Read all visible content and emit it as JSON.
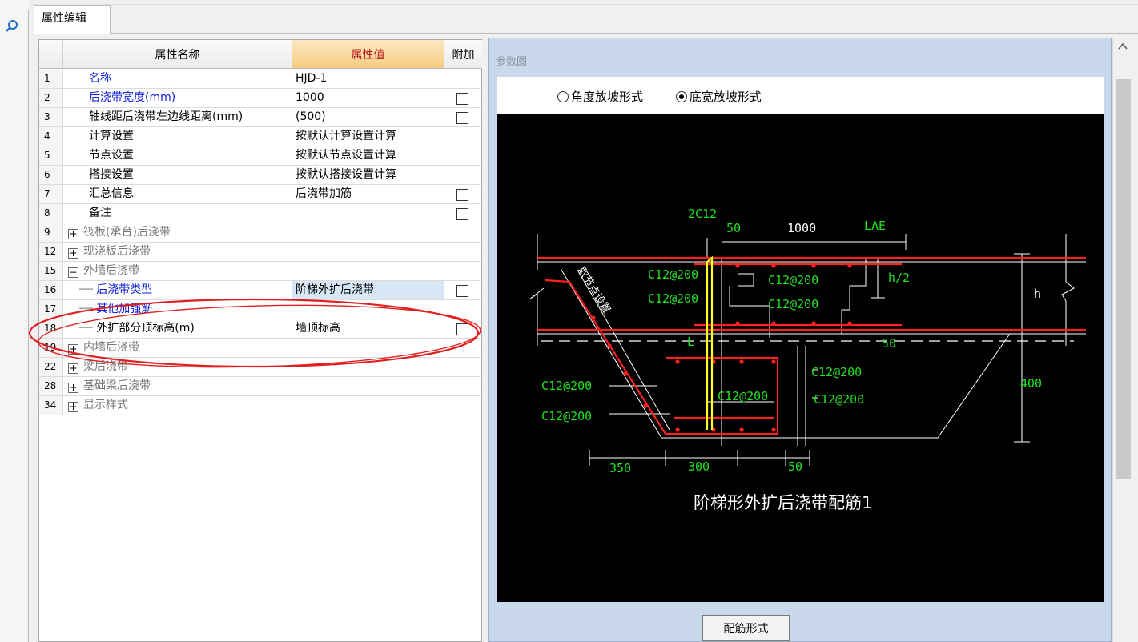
{
  "tab": {
    "label": "属性编辑"
  },
  "table": {
    "headers": {
      "name": "属性名称",
      "value": "属性值",
      "extra": "附加"
    },
    "rows": [
      {
        "no": "1",
        "name": "名称",
        "value": "HJD-1",
        "style": "blue",
        "check": false
      },
      {
        "no": "2",
        "name": "后浇带宽度(mm)",
        "value": "1000",
        "style": "blue",
        "check": true
      },
      {
        "no": "3",
        "name": "轴线距后浇带左边线距离(mm)",
        "value": "(500)",
        "style": "",
        "check": true
      },
      {
        "no": "4",
        "name": "计算设置",
        "value": "按默认计算设置计算",
        "style": "",
        "check": false
      },
      {
        "no": "5",
        "name": "节点设置",
        "value": "按默认节点设置计算",
        "style": "",
        "check": false
      },
      {
        "no": "6",
        "name": "搭接设置",
        "value": "按默认搭接设置计算",
        "style": "",
        "check": false
      },
      {
        "no": "7",
        "name": "汇总信息",
        "value": "后浇带加筋",
        "style": "",
        "check": true
      },
      {
        "no": "8",
        "name": "备注",
        "value": "",
        "style": "",
        "check": true
      },
      {
        "no": "9",
        "name": "筏板(承台)后浇带",
        "value": "",
        "style": "group",
        "toggle": "+",
        "check": false
      },
      {
        "no": "12",
        "name": "现浇板后浇带",
        "value": "",
        "style": "group",
        "toggle": "+",
        "check": false
      },
      {
        "no": "15",
        "name": "外墙后浇带",
        "value": "",
        "style": "group",
        "toggle": "−",
        "check": false
      },
      {
        "no": "16",
        "name": "后浇带类型",
        "value": "阶梯外扩后浇带",
        "style": "child-selected",
        "check": true
      },
      {
        "no": "17",
        "name": "其他加强筋",
        "value": "",
        "style": "child-blue",
        "check": false
      },
      {
        "no": "18",
        "name": "外扩部分顶标高(m)",
        "value": "墙顶标高",
        "style": "child",
        "check": true
      },
      {
        "no": "19",
        "name": "内墙后浇带",
        "value": "",
        "style": "group",
        "toggle": "+",
        "check": false
      },
      {
        "no": "22",
        "name": "梁后浇带",
        "value": "",
        "style": "group",
        "toggle": "+",
        "check": false
      },
      {
        "no": "28",
        "name": "基础梁后浇带",
        "value": "",
        "style": "group",
        "toggle": "+",
        "check": false
      },
      {
        "no": "34",
        "name": "显示样式",
        "value": "",
        "style": "group",
        "toggle": "+",
        "check": false
      }
    ]
  },
  "panel": {
    "title": "参数图",
    "options": [
      {
        "label": "角度放坡形式",
        "selected": false
      },
      {
        "label": "底宽放坡形式",
        "selected": true
      }
    ],
    "button": "配筋形式"
  },
  "drawing": {
    "caption": "阶梯形外扩后浇带配筋1",
    "labels": {
      "top_bar": "2C12",
      "dim_50_top": "50",
      "dim_1000": "1000",
      "dim_lae": "LAE",
      "bar_a": "C12@200",
      "bar_b": "C12@200",
      "bar_c": "C12@200",
      "bar_d": "C12@200",
      "bar_e": "C12@200",
      "bar_f": "C12@200",
      "bar_g": "C12@200",
      "bar_h": "C12@200",
      "bar_i": "C12@200",
      "h2": "h/2",
      "h": "h",
      "L": "L",
      "dim_50_right": "50",
      "dim_400": "400",
      "dim_350": "350",
      "dim_300": "300",
      "dim_50_bottom": "50",
      "node_text": "取节点设置"
    }
  },
  "colors": {
    "highlight_header": "#f6cb80",
    "annotation": "#e02020",
    "rebar": "#ff2020",
    "dim_text": "#20e020"
  }
}
